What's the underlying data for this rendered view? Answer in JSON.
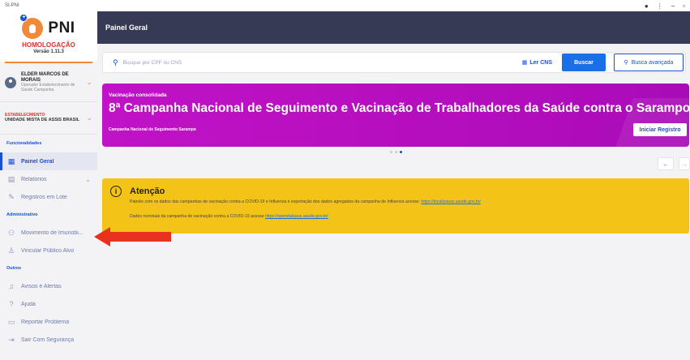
{
  "window": {
    "title": "SI-PNI",
    "controls": [
      "bell-icon",
      "more-icon",
      "minimize-icon",
      "restore-icon"
    ]
  },
  "logo": {
    "name": "PNI",
    "env": "HOMOLOGAÇÃO",
    "version": "Versão 1.11.3"
  },
  "user": {
    "name": "ELDER MARCOS DE MORAIS",
    "role": "Operador Estabelecimento de Saúde Campanha"
  },
  "establishment": {
    "label": "ESTABELECIMENTO",
    "name": "UNIDADE MISTA DE ASSIS BRASIL"
  },
  "sidebar": {
    "section_func": "Funcionalidades",
    "section_admin": "Administrativo",
    "section_outros": "Outros",
    "painel": "Painel Geral",
    "relatorios": "Relatórios",
    "registros": "Registros em Lote",
    "movimento": "Movimento de Imunobi...",
    "vincular": "Vincular Público Alvo",
    "avisos": "Avisos e Alertas",
    "ajuda": "Ajuda",
    "reportar": "Reportar Problema",
    "sair": "Sair Com Segurança"
  },
  "header": {
    "title": "Painel Geral"
  },
  "search": {
    "placeholder": "Busque por CPF ou CNS",
    "ler_cns": "Ler CNS",
    "buscar": "Buscar",
    "busca_avancada": "Busca avançada"
  },
  "banner": {
    "subtitle": "Vacinação consolidada",
    "title": "8ª Campanha Nacional de Seguimento e Vacinação de Trabalhadores da Saúde contra o Sarampo",
    "small": "Campanha Nacional de Seguimento Sarampo",
    "button": "Iniciar Registro",
    "color": "#c012c6"
  },
  "carousel": {
    "prev": "←",
    "next": "→"
  },
  "attention": {
    "title": "Atenção",
    "line1_text": "Painéis com os dados das campanhas de vacinação contra a COVID-19 e Influenza e exportação dos dados agregados da campanha de Influenza acesse: ",
    "line1_link": "https://localizasus.saude.gov.br/",
    "line2_text": "Dados nominais da campanha de vacinação contra a COVID-19 acesse ",
    "line2_link": "https://opendatasus.saude.gov.br/",
    "color": "#f3c417"
  },
  "colors": {
    "header": "#353b55",
    "primary": "#1a4fd6",
    "accent": "#f08a3a",
    "annotation": "#e8311f"
  }
}
